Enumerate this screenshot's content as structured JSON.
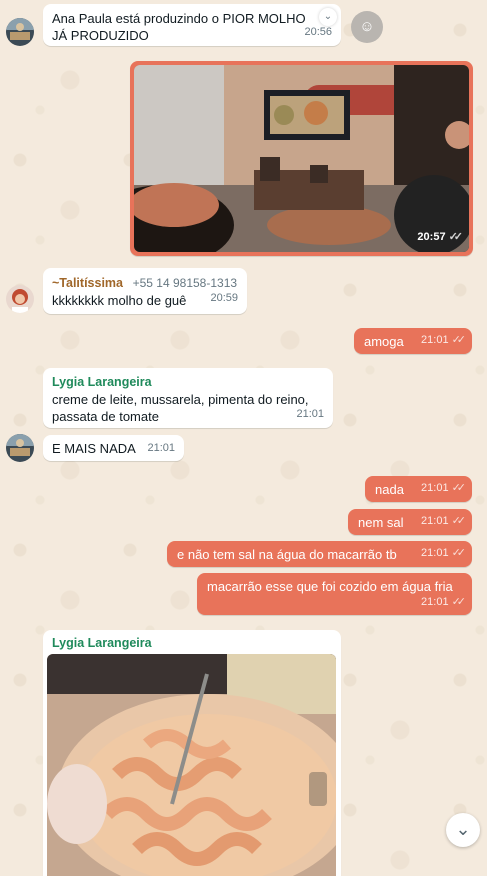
{
  "messages": [
    {
      "text": "Ana Paula está produzindo o PIOR MOLHO JÁ PRODUZIDO",
      "time": "20:56"
    },
    {
      "time": "20:57"
    },
    {
      "sender": "~Talitíssima",
      "phone": "+55 14 98158-1313",
      "text": "kkkkkkkk molho de guê",
      "time": "20:59"
    },
    {
      "text": "amoga",
      "time": "21:01"
    },
    {
      "sender": "Lygia Larangeira",
      "text": "creme de leite, mussarela, pimenta do reino, passata de tomate",
      "time": "21:01"
    },
    {
      "text": "E MAIS NADA",
      "time": "21:01"
    },
    {
      "text": "nada",
      "time": "21:01"
    },
    {
      "text": "nem sal",
      "time": "21:01"
    },
    {
      "text": "e não tem sal na água do macarrão tb",
      "time": "21:01"
    },
    {
      "text": "macarrão esse que foi cozido em água fria",
      "time": "21:01"
    },
    {
      "sender": "Lygia Larangeira"
    }
  ],
  "colors": {
    "outgoing": "#e8735a",
    "incoming": "#ffffff",
    "sender_talitissima": "#a0672a",
    "sender_lygia": "#1f8a5b",
    "background": "#f4eadd"
  },
  "icons": {
    "reaction": "emoji-icon",
    "scroll": "chevron-down-icon",
    "menu": "chevron-down-icon",
    "read": "double-check-icon"
  }
}
